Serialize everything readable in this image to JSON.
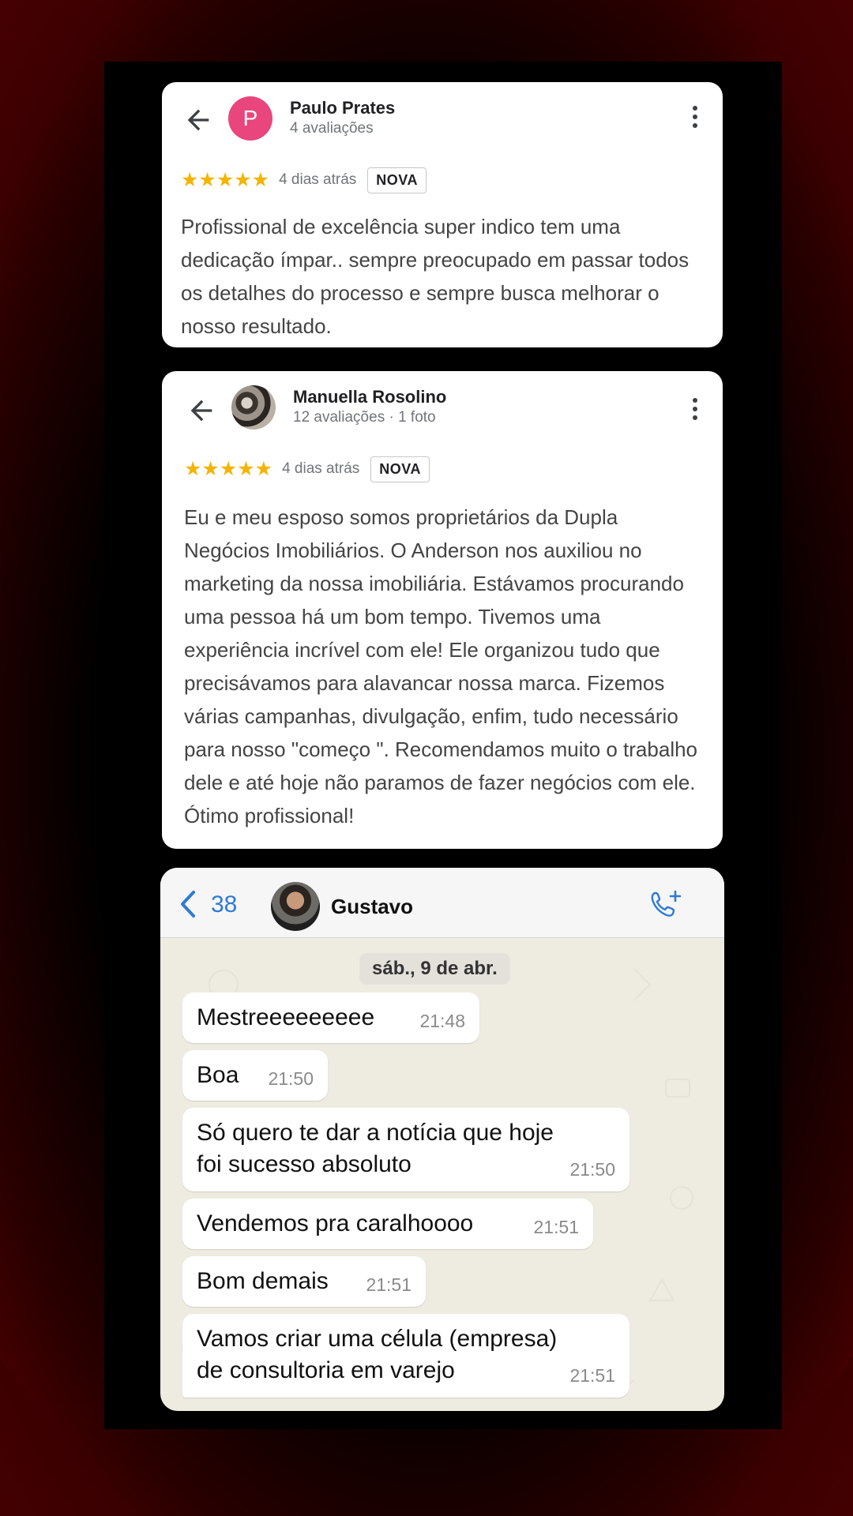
{
  "reviews": [
    {
      "name": "Paulo Prates",
      "avatar_initial": "P",
      "subtitle": "4 avaliações",
      "stars": "★★★★★",
      "rating": 5,
      "date": "4 dias atrás",
      "badge": "NOVA",
      "text": "Profissional de excelência super indico tem uma dedicação ímpar.. sempre preocupado em passar todos os detalhes do processo e sempre busca melhorar o nosso resultado."
    },
    {
      "name": "Manuella Rosolino",
      "subtitle": "12 avaliações · 1 foto",
      "stars": "★★★★★",
      "rating": 5,
      "date": "4 dias atrás",
      "badge": "NOVA",
      "text": "Eu e meu esposo somos proprietários da Dupla Negócios Imobiliários. O Anderson nos auxiliou no marketing da nossa imobiliária. Estávamos procurando uma pessoa há um bom tempo. Tivemos uma experiência incrível com ele! Ele organizou tudo que precisávamos para alavancar nossa marca. Fizemos várias campanhas, divulgação, enfim, tudo necessário para nosso \"começo \". Recomendamos muito o trabalho dele e até hoje não paramos de fazer negócios com ele. Ótimo profissional!"
    }
  ],
  "chat": {
    "back_count": "38",
    "contact_name": "Gustavo",
    "date_label": "sáb., 9 de abr.",
    "messages": [
      {
        "text": "Mestreeeeeeeee",
        "time": "21:48"
      },
      {
        "text": "Boa",
        "time": "21:50"
      },
      {
        "text": "Só quero te dar a notícia que hoje\nfoi sucesso absoluto",
        "time": "21:50"
      },
      {
        "text": "Vendemos pra caralhoooo",
        "time": "21:51"
      },
      {
        "text": "Bom demais",
        "time": "21:51"
      },
      {
        "text": "Vamos criar uma célula (empresa)\nde consultoria em varejo",
        "time": "21:51"
      }
    ]
  },
  "colors": {
    "star": "#f4b400",
    "avatar_pink": "#e8467c",
    "ios_blue": "#2e7bd6",
    "chat_wallpaper": "#eeebe1"
  }
}
